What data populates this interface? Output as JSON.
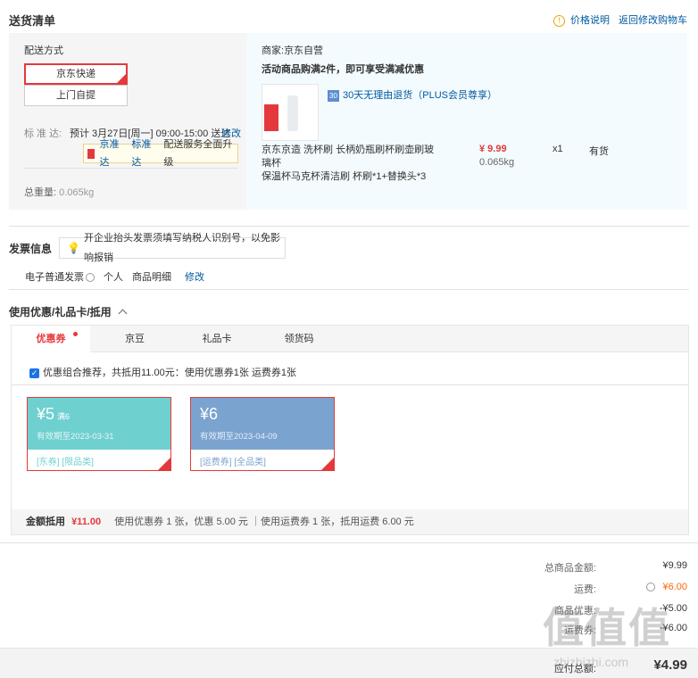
{
  "header": {
    "title": "送货清单",
    "price_info": "价格说明",
    "back_cart": "返回修改购物车"
  },
  "shipping": {
    "method_label": "配送方式",
    "options": [
      "京东快递",
      "上门自提"
    ],
    "selected": "京东快递",
    "standard_label": "标 准 达:",
    "standard_value": "预计 3月27日[周一] 09:00-15:00 送达",
    "modify": "修改",
    "tip_links": [
      "京准达",
      "标准达"
    ],
    "tip_text": "配送服务全面升级",
    "weight_label": "总重量:",
    "weight_value": "0.065kg"
  },
  "seller": {
    "label": "商家:",
    "name": "京东自营",
    "promo": "活动商品购满2件，即可享受满减优惠",
    "return_badge": "30",
    "return_text": "30天无理由退货（PLUS会员尊享）",
    "product": {
      "name_line1": "京东京造 洗杯刷 长柄奶瓶刷杯刷壶刷玻璃杯",
      "name_line2": "保温杯马克杯清洁刷 杯刷*1+替换头*3",
      "price": "¥ 9.99",
      "weight": "0.065kg",
      "qty": "x1",
      "stock": "有货"
    }
  },
  "invoice": {
    "title": "发票信息",
    "tip": "开企业抬头发票须填写纳税人识别号，以免影响报销",
    "type": "电子普通发票",
    "holder": "个人",
    "content": "商品明细",
    "modify": "修改"
  },
  "discounts": {
    "title": "使用优惠/礼品卡/抵用",
    "tabs": [
      "优惠券",
      "京豆",
      "礼品卡",
      "领货码"
    ],
    "recommend_text": "优惠组合推荐，共抵用11.00元：使用优惠券1张 运费券1张",
    "coupons": [
      {
        "amount": "¥5",
        "condition": "满6",
        "expiry": "有效期至2023-03-31",
        "tags": "[东券] [限品类]",
        "color": "#6fd0d0"
      },
      {
        "amount": "¥6",
        "condition": "",
        "expiry": "有效期至2023-04-09",
        "tags": "[运费券] [全品类]",
        "color": "#7ba3cf"
      }
    ],
    "summary_label": "金额抵用",
    "summary_amount": "¥11.00",
    "summary_detail": "使用优惠券 1 张，优惠 5.00 元 ｜使用运费券 1 张，抵用运费 6.00 元"
  },
  "totals": {
    "goods_label": "总商品金额:",
    "goods_value": "¥9.99",
    "freight_label": "运费:",
    "freight_value": "¥6.00",
    "discount_label": "商品优惠:",
    "discount_value": "-¥5.00",
    "freight_coupon_label": "运费券:",
    "freight_coupon_value": "-¥6.00",
    "payable_label": "应付总额:",
    "payable_value": "¥4.99"
  },
  "watermark": {
    "big": "值值值",
    "small": "zhizhizhi.com"
  }
}
